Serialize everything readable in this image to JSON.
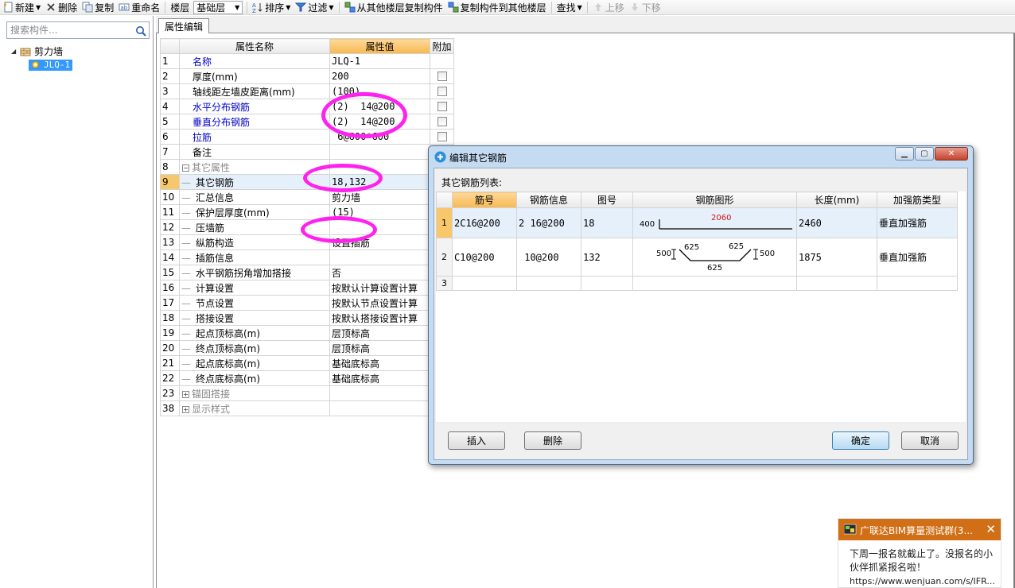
{
  "toolbar": {
    "new_label": "新建",
    "delete_label": "删除",
    "copy_label": "复制",
    "rename_label": "重命名",
    "floor_label": "楼层",
    "floor_value": "基础层",
    "sort_label": "排序",
    "filter_label": "过滤",
    "copy_from_floor_label": "从其他楼层复制构件",
    "copy_to_floor_label": "复制构件到其他楼层",
    "find_label": "查找",
    "move_up_label": "上移",
    "move_down_label": "下移"
  },
  "left_panel": {
    "search_placeholder": "搜索构件...",
    "tree_root": "剪力墙",
    "tree_child": "JLQ-1"
  },
  "prop_tab": "属性编辑",
  "prop_table": {
    "headers": {
      "name": "属性名称",
      "value": "属性值",
      "extra": "附加"
    },
    "rows": [
      {
        "idx": "1",
        "name": "名称",
        "value": "JLQ-1"
      },
      {
        "idx": "2",
        "name": "厚度(mm)",
        "value": "200"
      },
      {
        "idx": "3",
        "name": "轴线距左墙皮距离(mm)",
        "value": "(100)"
      },
      {
        "idx": "4",
        "name": "水平分布钢筋",
        "value": "(2)  14@200"
      },
      {
        "idx": "5",
        "name": "垂直分布钢筋",
        "value": "(2)  14@200"
      },
      {
        "idx": "6",
        "name": "拉筋",
        "value": " 6@600*600"
      },
      {
        "idx": "7",
        "name": "备注",
        "value": ""
      },
      {
        "idx": "8",
        "name": "其它属性",
        "value": ""
      },
      {
        "idx": "9",
        "name": "其它钢筋",
        "value": "18,132"
      },
      {
        "idx": "10",
        "name": "汇总信息",
        "value": "剪力墙"
      },
      {
        "idx": "11",
        "name": "保护层厚度(mm)",
        "value": "(15)"
      },
      {
        "idx": "12",
        "name": "压墙筋",
        "value": ""
      },
      {
        "idx": "13",
        "name": "纵筋构造",
        "value": "设置插筋"
      },
      {
        "idx": "14",
        "name": "插筋信息",
        "value": ""
      },
      {
        "idx": "15",
        "name": "水平钢筋拐角增加搭接",
        "value": "否"
      },
      {
        "idx": "16",
        "name": "计算设置",
        "value": "按默认计算设置计算"
      },
      {
        "idx": "17",
        "name": "节点设置",
        "value": "按默认节点设置计算"
      },
      {
        "idx": "18",
        "name": "搭接设置",
        "value": "按默认搭接设置计算"
      },
      {
        "idx": "19",
        "name": "起点顶标高(m)",
        "value": "层顶标高"
      },
      {
        "idx": "20",
        "name": "终点顶标高(m)",
        "value": "层顶标高"
      },
      {
        "idx": "21",
        "name": "起点底标高(m)",
        "value": "基础底标高"
      },
      {
        "idx": "22",
        "name": "终点底标高(m)",
        "value": "基础底标高"
      },
      {
        "idx": "23",
        "name": "锚固搭接",
        "value": ""
      },
      {
        "idx": "38",
        "name": "显示样式",
        "value": ""
      }
    ]
  },
  "dialog": {
    "title": "编辑其它钢筋",
    "list_label": "其它钢筋列表:",
    "headers": [
      "筋号",
      "钢筋信息",
      "图号",
      "钢筋图形",
      "长度(mm)",
      "加强筋类型"
    ],
    "rows": [
      {
        "idx": "1",
        "bar_no": "2C16@200",
        "info": "2 16@200",
        "fig": "18",
        "length": "2460",
        "type": "垂直加强筋",
        "shape": {
          "left": "400",
          "main": "2060"
        }
      },
      {
        "idx": "2",
        "bar_no": "C10@200",
        "info": " 10@200",
        "fig": "132",
        "length": "1875",
        "type": "垂直加强筋",
        "shape": {
          "left": "500",
          "top_left": "625",
          "top_right": "625",
          "right": "500",
          "bottom": "625"
        }
      },
      {
        "idx": "3",
        "bar_no": "",
        "info": "",
        "fig": "",
        "length": "",
        "type": ""
      }
    ],
    "insert_label": "插入",
    "delete_label": "删除",
    "ok_label": "确定",
    "cancel_label": "取消"
  },
  "toast": {
    "title": "广联达BIM算量测试群(3...",
    "body": "下周一报名就截止了。没报名的小伙伴抓紧报名啦！",
    "link": "https://www.wenjuan.com/s/IFR..."
  }
}
